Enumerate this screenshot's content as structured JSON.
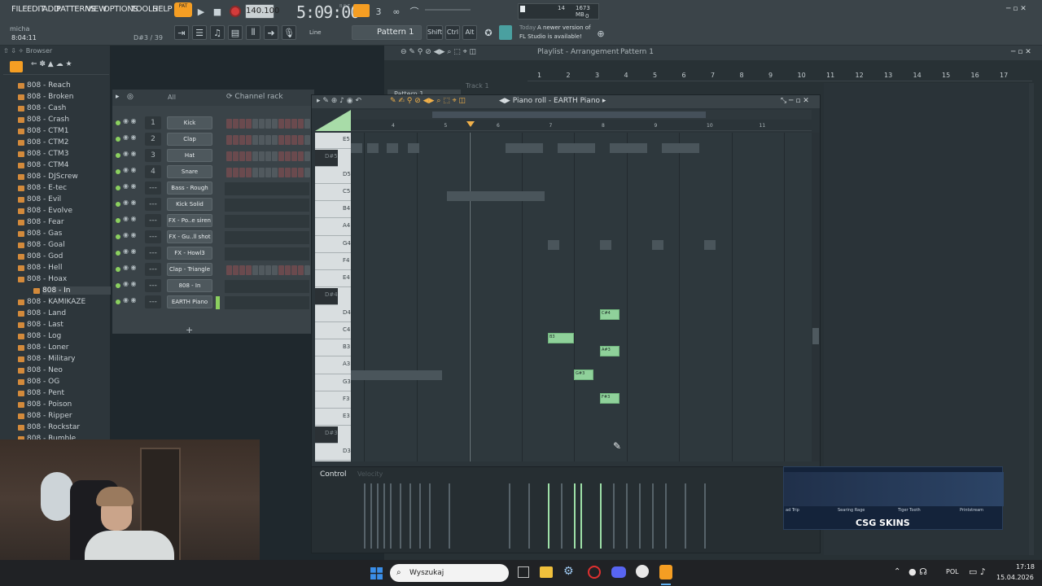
{
  "menu": {
    "items": [
      "FILE",
      "EDIT",
      "ADD",
      "PATTERNS",
      "VIEW",
      "OPTIONS",
      "TOOLS",
      "HELP"
    ]
  },
  "transport": {
    "mode": "PAT",
    "tempo": "140.100",
    "time": "5:09:00",
    "time_small": "B:S:T",
    "cpu_voices": "14",
    "ram": "1673 MB",
    "cpu_value": "0"
  },
  "hint": {
    "user": "micha",
    "position": "8:04:11",
    "key_info": "D#3 / 39"
  },
  "toolbar": {
    "snap": "Line",
    "pattern": "Pattern 1",
    "shift": "Shift",
    "ctrl": "Ctrl",
    "alt": "Alt"
  },
  "news": {
    "label": "Today",
    "line1": "A newer version of",
    "line2": "FL Studio is available!"
  },
  "browser": {
    "title": "Browser",
    "items": [
      "808 - Reach",
      "808 - Broken",
      "808 - Cash",
      "808 - Crash",
      "808 - CTM1",
      "808 - CTM2",
      "808 - CTM3",
      "808 - CTM4",
      "808 - DJScrew",
      "808 - E-tec",
      "808 - Evil",
      "808 - Evolve",
      "808 - Fear",
      "808 - Gas",
      "808 - Goal",
      "808 - God",
      "808 - Hell",
      "808 - Hoax",
      "808 - In",
      "808 - KAMIKAZE",
      "808 - Land",
      "808 - Last",
      "808 - Log",
      "808 - Loner",
      "808 - Military",
      "808 - Neo",
      "808 - OG",
      "808 - Pent",
      "808 - Poison",
      "808 - Ripper",
      "808 - Rockstar",
      "808 - Rumble"
    ]
  },
  "channel_rack": {
    "filter": "All",
    "title": "Channel rack",
    "channels": [
      {
        "num": "1",
        "name": "Kick"
      },
      {
        "num": "2",
        "name": "Clap"
      },
      {
        "num": "3",
        "name": "Hat"
      },
      {
        "num": "4",
        "name": "Snare"
      },
      {
        "num": "---",
        "name": "Bass - Rough"
      },
      {
        "num": "---",
        "name": "Kick Solid"
      },
      {
        "num": "---",
        "name": "FX - Po..e siren"
      },
      {
        "num": "---",
        "name": "FX - Gu..ll shot"
      },
      {
        "num": "---",
        "name": "FX - Howl3"
      },
      {
        "num": "---",
        "name": "Clap - Triangle"
      },
      {
        "num": "---",
        "name": "808 - In"
      },
      {
        "num": "---",
        "name": "EARTH Piano"
      }
    ],
    "add": "+"
  },
  "playlist": {
    "title": "Playlist - Arrangement",
    "pattern": "Pattern 1",
    "track": "Pattern 1",
    "track_name": "Track 1",
    "ruler": [
      "1",
      "2",
      "3",
      "4",
      "5",
      "6",
      "7",
      "8",
      "9",
      "10",
      "11",
      "12",
      "13",
      "14",
      "15",
      "16",
      "17"
    ]
  },
  "piano_roll": {
    "title": "Piano roll - EARTH Piano",
    "ruler": [
      "4",
      "5",
      "6",
      "7",
      "8",
      "9",
      "10",
      "11"
    ],
    "keys": [
      "E5",
      "D#5",
      "D5",
      "C5",
      "B4",
      "A4",
      "G4",
      "F4",
      "E4",
      "D#4",
      "D4",
      "C4",
      "B3",
      "A3",
      "G3",
      "F3",
      "E3",
      "D#3",
      "D3"
    ],
    "notes": [
      {
        "label": "C#4"
      },
      {
        "label": "B3"
      },
      {
        "label": "A#3"
      },
      {
        "label": "G#3"
      },
      {
        "label": "F#3"
      }
    ],
    "control_label": "Control",
    "control_param": "Velocity"
  },
  "sponsor": {
    "brand": "CSG SKINS",
    "items": [
      "ad Trip",
      "Searing Rage",
      "Tiger Tooth",
      "Printstream"
    ]
  },
  "taskbar": {
    "search": "Wyszukaj",
    "lang": "POL",
    "time": "17:18",
    "date": "15.04.2026"
  },
  "colors": {
    "accent_orange": "#f59e23",
    "note_green": "#8fd19a",
    "bg_dark": "#283135"
  }
}
